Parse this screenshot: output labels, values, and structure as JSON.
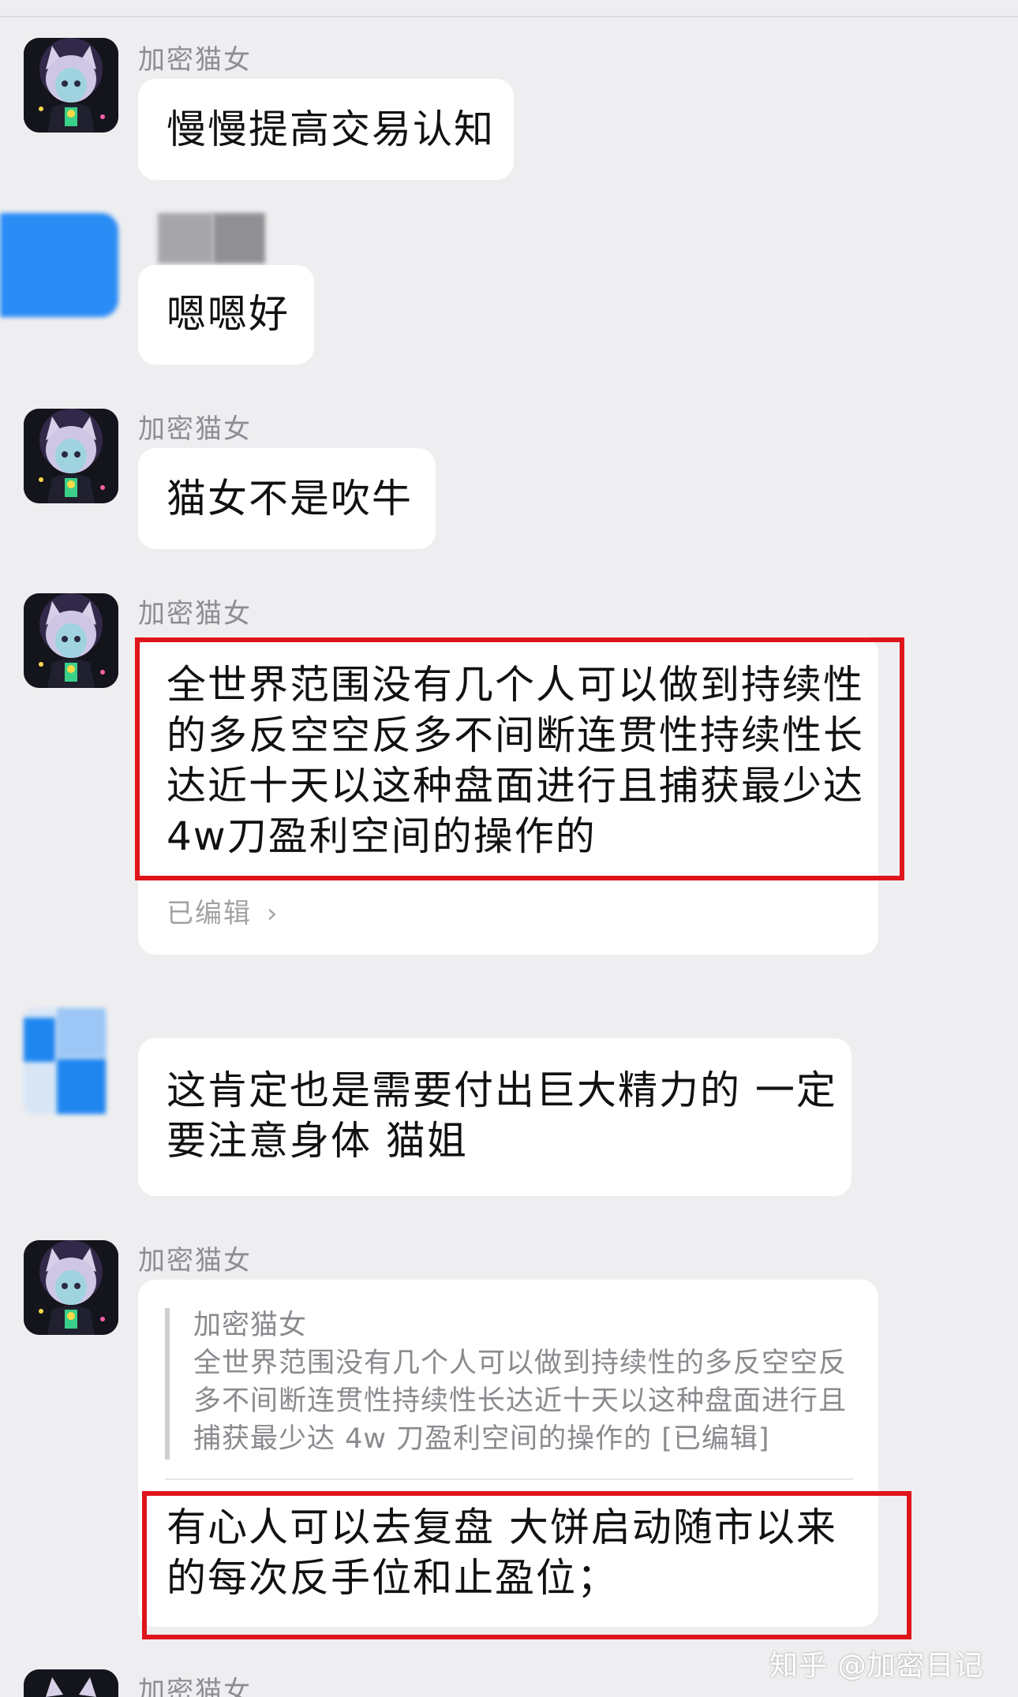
{
  "messages": [
    {
      "sender": "加密猫女",
      "lines": [
        "慢慢提高交易认知"
      ]
    },
    {
      "sender": "",
      "lines": [
        "嗯嗯好"
      ]
    },
    {
      "sender": "加密猫女",
      "lines": [
        "猫女不是吹牛"
      ]
    },
    {
      "sender": "加密猫女",
      "lines": [
        "全世界范围没有几个人可以做到持续性",
        "的多反空空反多不间断连贯性持续性长",
        "达近十天以这种盘面进行且捕获最少达",
        "4w刀盈利空间的操作的"
      ],
      "edited_label": "已编辑"
    },
    {
      "sender": "",
      "lines": [
        "这肯定也是需要付出巨大精力的 一定",
        "要注意身体 猫姐"
      ]
    },
    {
      "sender": "加密猫女",
      "quote": {
        "sender": "加密猫女",
        "lines": [
          "全世界范围没有几个人可以做到持续性的多反空空反",
          "多不间断连贯性持续性长达近十天以这种盘面进行且",
          "捕获最少达 4w 刀盈利空间的操作的 [已编辑]"
        ]
      },
      "lines": [
        "有心人可以去复盘 大饼启动随市以来",
        "的每次反手位和止盈位；"
      ]
    },
    {
      "sender": "加密猫女"
    }
  ],
  "watermark": "知乎 @加密日记",
  "colors": {
    "background": "#eeeef0",
    "bubble": "#ffffff",
    "highlight_border": "#e0141b",
    "name_text": "#8d8d92"
  },
  "icons": {
    "avatar": "cat-girl-avatar",
    "chevron": "chevron-right-icon"
  },
  "chevron_glyph": "›"
}
